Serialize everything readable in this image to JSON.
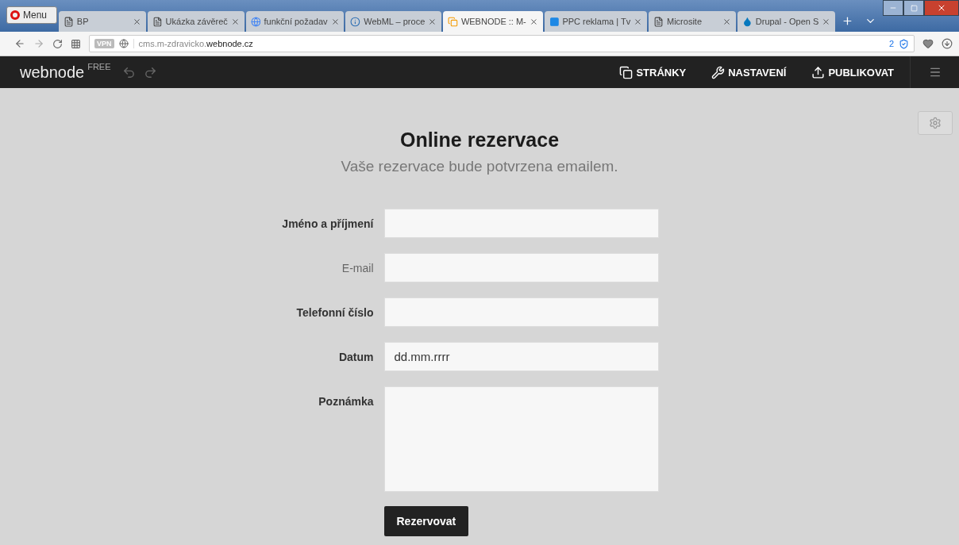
{
  "browser": {
    "menu_label": "Menu",
    "tabs": [
      {
        "title": "BP",
        "kind": "page",
        "selected": false
      },
      {
        "title": "Ukázka závěreč",
        "kind": "page",
        "selected": false
      },
      {
        "title": "funkční požadav",
        "kind": "search",
        "selected": false
      },
      {
        "title": "WebML – proce",
        "kind": "info",
        "selected": false
      },
      {
        "title": "WEBNODE :: M-",
        "kind": "site",
        "selected": true
      },
      {
        "title": "PPC reklama | Tv",
        "kind": "ads",
        "selected": false
      },
      {
        "title": "Microsite",
        "kind": "page",
        "selected": false
      },
      {
        "title": "Drupal - Open S",
        "kind": "cms",
        "selected": false
      }
    ],
    "vpn_label": "VPN",
    "url_prefix": "cms.m-zdravicko.",
    "url_domain": "webnode.cz",
    "blocked_count": "2"
  },
  "editor_bar": {
    "logo": "webnode",
    "plan": "FREE",
    "actions": [
      {
        "label": "STRÁNKY",
        "kind": "pages"
      },
      {
        "label": "NASTAVENÍ",
        "kind": "settings"
      },
      {
        "label": "PUBLIKOVAT",
        "kind": "publish"
      }
    ]
  },
  "form": {
    "title": "Online rezervace",
    "subtitle": "Vaše rezervace bude potvrzena emailem.",
    "fields": [
      {
        "label": "Jméno a příjmení",
        "bold": true,
        "kind": "input"
      },
      {
        "label": "E-mail",
        "bold": false,
        "kind": "input"
      },
      {
        "label": "Telefonní číslo",
        "bold": true,
        "kind": "input"
      },
      {
        "label": "Datum",
        "bold": true,
        "kind": "input",
        "placeholder": "dd.mm.rrrr"
      },
      {
        "label": "Poznámka",
        "bold": true,
        "kind": "textarea"
      }
    ],
    "submit": "Rezervovat"
  }
}
